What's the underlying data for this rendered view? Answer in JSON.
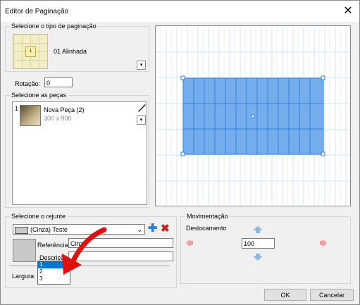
{
  "window": {
    "title": "Editor de Paginação",
    "close_glyph": "✕"
  },
  "pagination": {
    "group_label": "Selecione o tipo de paginação",
    "type_name": "01 Alinhada",
    "tile_center_glyph": "1",
    "rotation_label": "Rotação:",
    "rotation_value": "0"
  },
  "pieces": {
    "group_label": "Selecione as peças",
    "items": [
      {
        "index": "1",
        "name": "Nova Peça (2)",
        "size": "300 x 900"
      }
    ]
  },
  "grout": {
    "group_label": "Selecione o rejunte",
    "selected": "(Cinza) Teste",
    "swatch_color": "#c8c8c8",
    "reference_label": "Referência",
    "reference_value": "Cinza",
    "description_label": "Descrição",
    "description_value": "",
    "width_label": "Largura:",
    "width_value": "1",
    "width_options": [
      "1",
      "2",
      "3"
    ],
    "add_icon_color": "#2a7fd4",
    "delete_icon_color": "#d02020"
  },
  "movement": {
    "group_label": "Movimentação",
    "offset_label": "Deslocamento",
    "offset_value": "100"
  },
  "buttons": {
    "ok": "OK",
    "cancel": "Cancelar"
  },
  "annotation": {
    "arrow_color": "#e01010"
  },
  "colors": {
    "selection_fill": "#3d8de6",
    "grid_line": "#c7e0f7"
  }
}
